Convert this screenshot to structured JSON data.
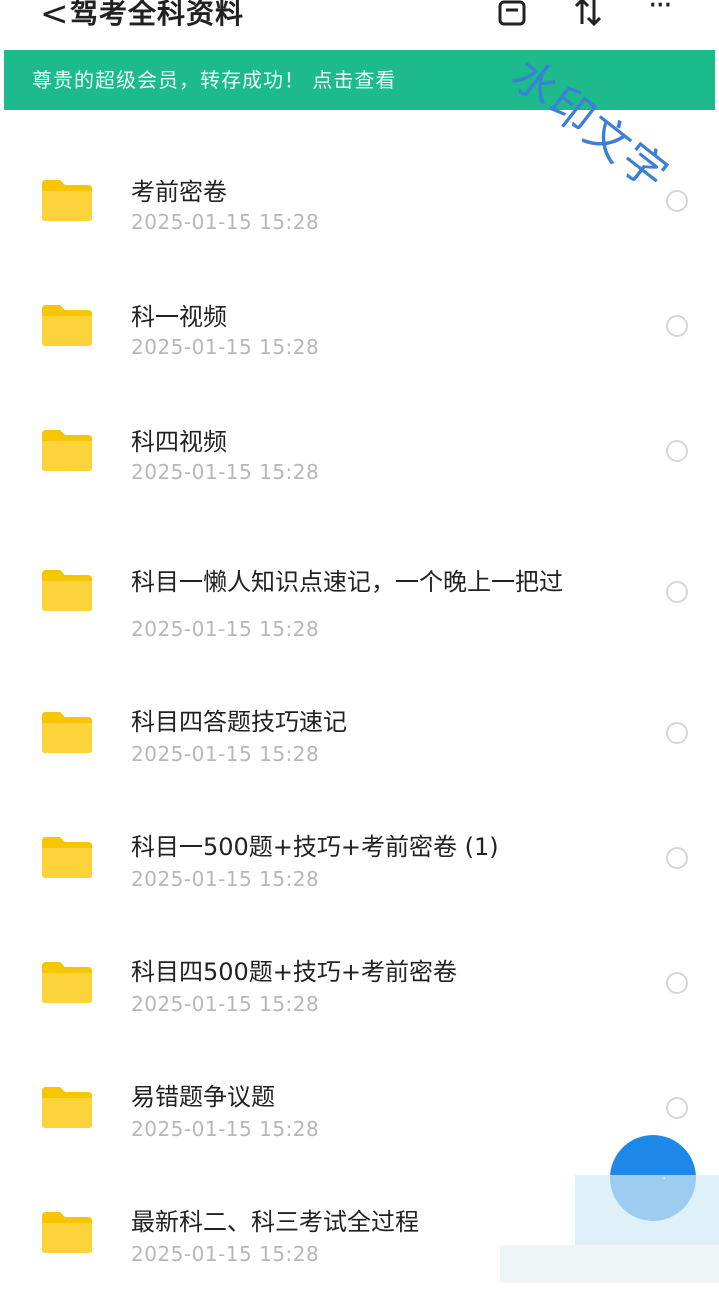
{
  "header": {
    "back_glyph": "<",
    "title": "驾考全科资料",
    "more_glyph": "···"
  },
  "banner": {
    "text": "尊贵的超级会员，转存成功！ 点击查看"
  },
  "watermark": "水印文字",
  "files": [
    {
      "name": "考前密卷",
      "date": "2025-01-15 15:28"
    },
    {
      "name": "科一视频",
      "date": "2025-01-15 15:28"
    },
    {
      "name": "科四视频",
      "date": "2025-01-15 15:28"
    },
    {
      "name": "科目一懒人知识点速记，一个晚上一把过",
      "date": "2025-01-15 15:28"
    },
    {
      "name": "科目四答题技巧速记",
      "date": "2025-01-15 15:28"
    },
    {
      "name": "科目一500题+技巧+考前密卷 (1)",
      "date": "2025-01-15 15:28"
    },
    {
      "name": "科目四500题+技巧+考前密卷",
      "date": "2025-01-15 15:28"
    },
    {
      "name": "易错题争议题",
      "date": "2025-01-15 15:28"
    },
    {
      "name": "最新科二、科三考试全过程",
      "date": "2025-01-15 15:28"
    }
  ],
  "colors": {
    "accent": "#1dba8c",
    "folder": "#f7c600",
    "fab": "#1e88e8"
  }
}
